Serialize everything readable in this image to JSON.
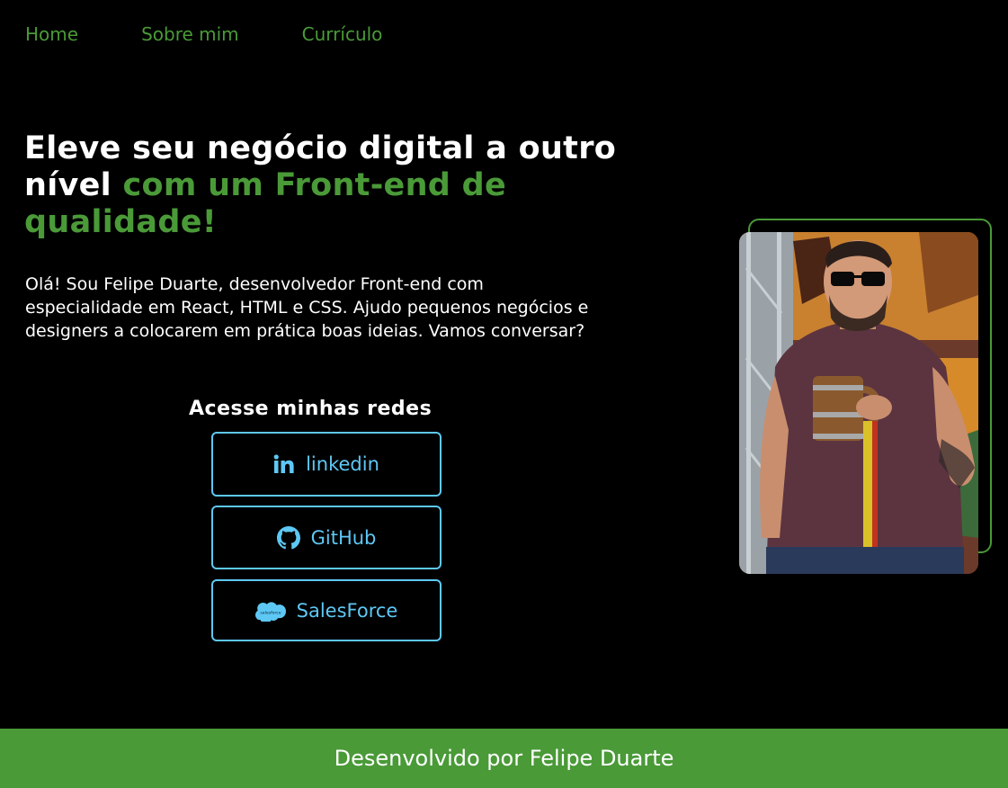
{
  "nav": {
    "items": [
      {
        "label": "Home"
      },
      {
        "label": "Sobre mim"
      },
      {
        "label": "Currículo"
      }
    ]
  },
  "hero": {
    "title_white": "Eleve seu negócio digital a outro nível",
    "title_accent": "com um Front-end de qualidade!",
    "intro": "Olá! Sou Felipe Duarte, desenvolvedor Front-end com especialidade em React, HTML e CSS. Ajudo pequenos negócios e designers a colocarem em prática boas ideias. Vamos conversar?"
  },
  "social": {
    "heading": "Acesse minhas redes",
    "buttons": [
      {
        "label": "linkedin",
        "icon": "linkedin-icon"
      },
      {
        "label": "GitHub",
        "icon": "github-icon"
      },
      {
        "label": "SalesForce",
        "icon": "salesforce-icon"
      }
    ]
  },
  "footer": {
    "text": "Desenvolvido por Felipe Duarte"
  },
  "colors": {
    "accent_green": "#4a9a38",
    "link_blue": "#5ec8f5",
    "background": "#000000",
    "text": "#ffffff"
  }
}
